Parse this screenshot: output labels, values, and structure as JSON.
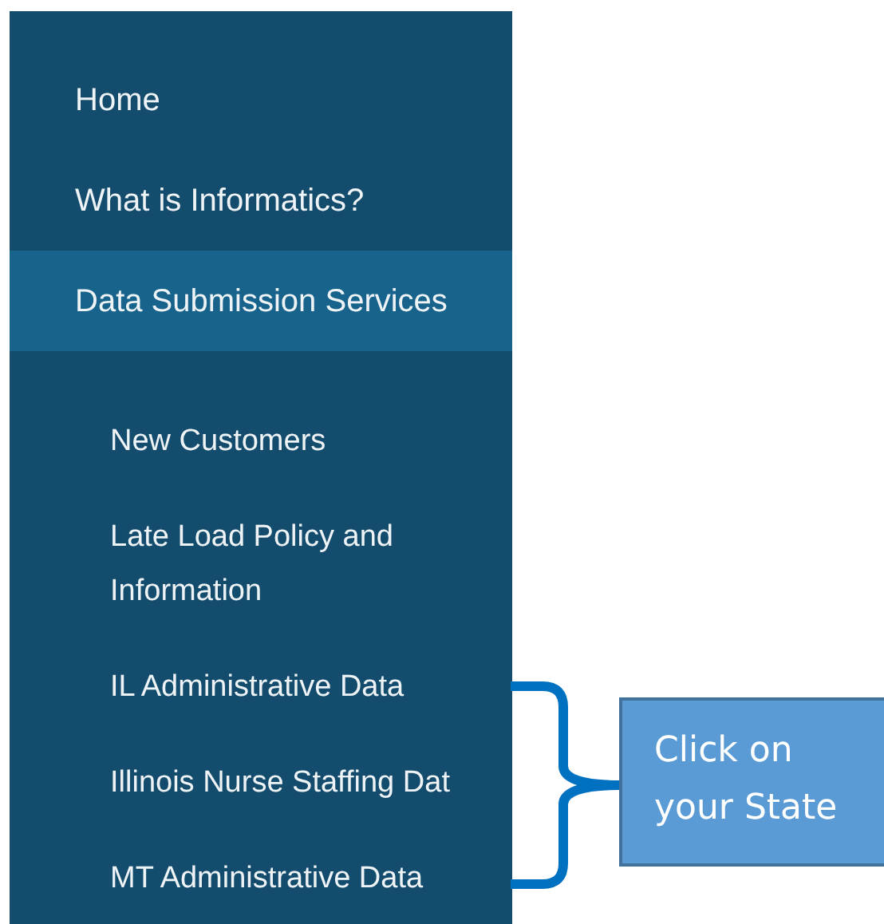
{
  "sidebar": {
    "items": [
      {
        "label": "Home",
        "selected": false
      },
      {
        "label": "What is Informatics?",
        "selected": false
      },
      {
        "label": "Data Submission Services",
        "selected": true,
        "children": [
          {
            "label": "New Customers"
          },
          {
            "label": "Late Load Policy and Information"
          },
          {
            "label": "IL Administrative Data"
          },
          {
            "label": "Illinois Nurse Staffing Dat"
          },
          {
            "label": "MT Administrative Data"
          }
        ]
      }
    ]
  },
  "callout": {
    "text": "Click on your State"
  }
}
